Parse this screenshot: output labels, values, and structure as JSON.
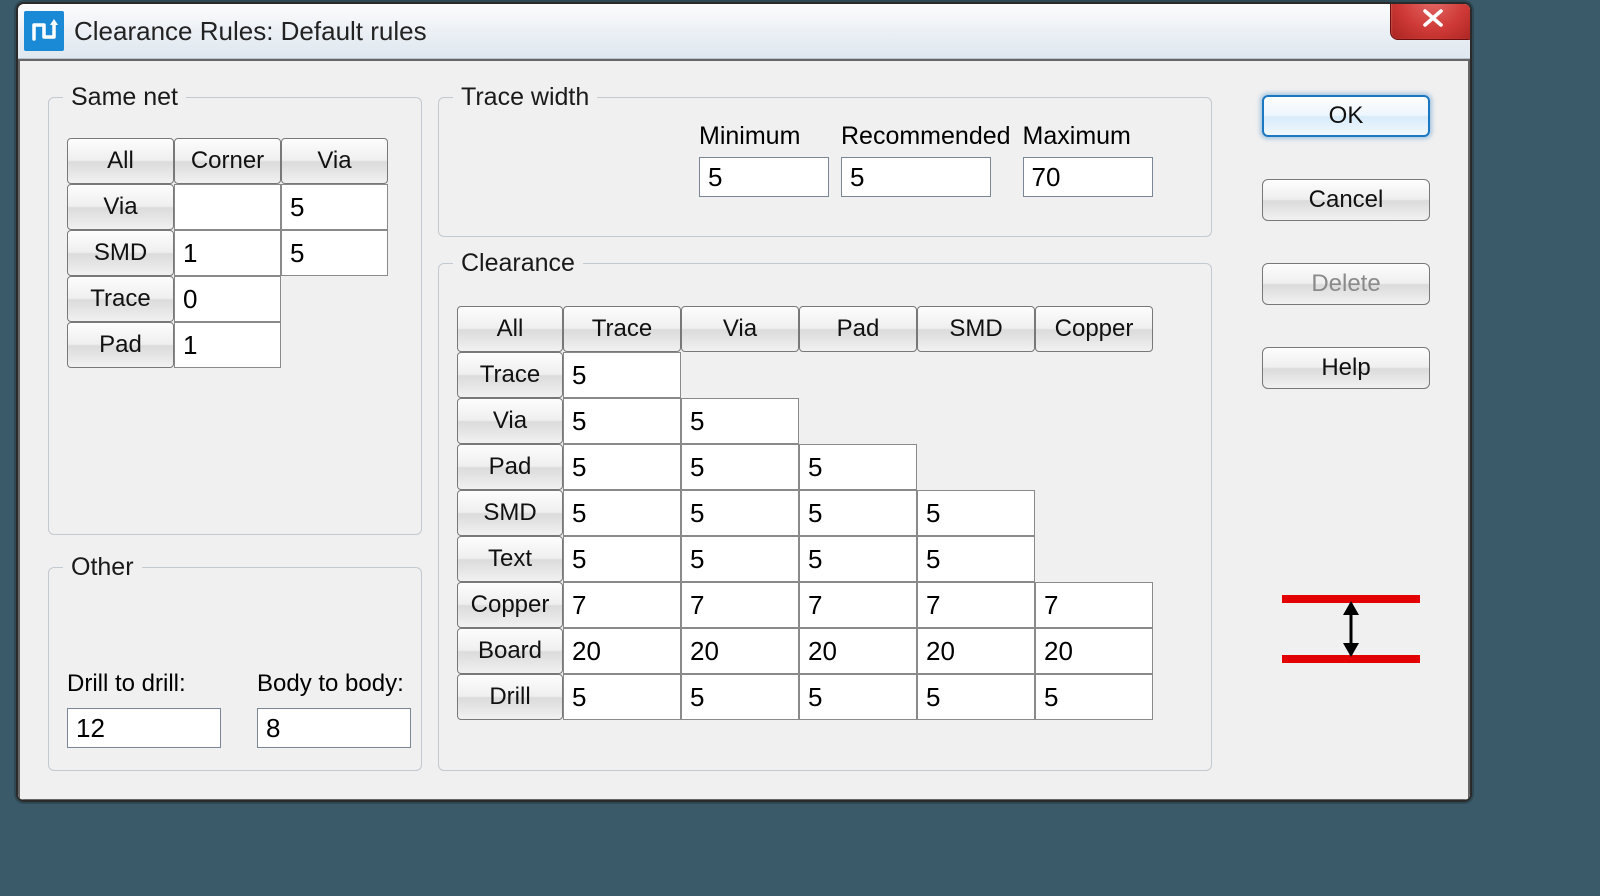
{
  "window": {
    "title": "Clearance Rules: Default rules"
  },
  "buttons": {
    "ok": "OK",
    "cancel": "Cancel",
    "delete": "Delete",
    "help": "Help",
    "close": "X"
  },
  "samenet": {
    "legend": "Same net",
    "headers": {
      "all": "All",
      "corner": "Corner",
      "via": "Via"
    },
    "rows": {
      "via": {
        "label": "Via",
        "corner": "",
        "via": "5"
      },
      "smd": {
        "label": "SMD",
        "corner": "1",
        "via": "5"
      },
      "trace": {
        "label": "Trace",
        "corner": "0"
      },
      "pad": {
        "label": "Pad",
        "corner": "1"
      }
    }
  },
  "other": {
    "legend": "Other",
    "drill_label": "Drill to drill:",
    "body_label": "Body to body:",
    "drill": "12",
    "body": "8"
  },
  "tracewidth": {
    "legend": "Trace width",
    "min_label": "Minimum",
    "rec_label": "Recommended",
    "max_label": "Maximum",
    "min": "5",
    "rec": "5",
    "max": "70"
  },
  "clearance": {
    "legend": "Clearance",
    "col_headers": {
      "all": "All",
      "trace": "Trace",
      "via": "Via",
      "pad": "Pad",
      "smd": "SMD",
      "copper": "Copper"
    },
    "rows": {
      "trace": {
        "label": "Trace",
        "v": [
          "5"
        ]
      },
      "via": {
        "label": "Via",
        "v": [
          "5",
          "5"
        ]
      },
      "pad": {
        "label": "Pad",
        "v": [
          "5",
          "5",
          "5"
        ]
      },
      "smd": {
        "label": "SMD",
        "v": [
          "5",
          "5",
          "5",
          "5"
        ]
      },
      "text": {
        "label": "Text",
        "v": [
          "5",
          "5",
          "5",
          "5"
        ]
      },
      "copper": {
        "label": "Copper",
        "v": [
          "7",
          "7",
          "7",
          "7",
          "7"
        ]
      },
      "board": {
        "label": "Board",
        "v": [
          "20",
          "20",
          "20",
          "20",
          "20"
        ]
      },
      "drill": {
        "label": "Drill",
        "v": [
          "5",
          "5",
          "5",
          "5",
          "5"
        ]
      }
    }
  }
}
